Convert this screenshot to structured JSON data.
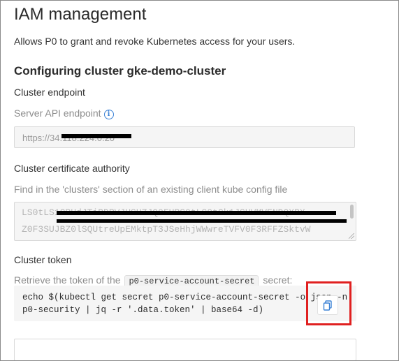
{
  "page": {
    "title": "IAM management",
    "description": "Allows P0 to grant and revoke Kubernetes access for your users.",
    "section_title": "Configuring cluster gke-demo-cluster"
  },
  "endpoint": {
    "label": "Cluster endpoint",
    "help": "Server API endpoint",
    "value": "https://34.118.224.0.20"
  },
  "certificate": {
    "label": "Cluster certificate authority",
    "help": "Find in the 'clusters' section of an existing client kube config file",
    "line1": "LS0tLS1CRUdJTiBDRVJUSUZJQ0FURS0tLS0tCk1JSUVMVENDQXBX",
    "line2": "Z0F3SUJBZ0lSQUtreUpEMktpT3JSeHhjWWwreTVFV0F3RFFZSktvW"
  },
  "token": {
    "label": "Cluster token",
    "help_prefix": "Retrieve the token of the",
    "secret_name": "p0-service-account-secret",
    "help_suffix": "secret:",
    "command_line1": "echo $(kubectl get secret p0-service-account-secret -o json -n",
    "command_line2": "p0-security | jq -r '.data.token' | base64 -d)"
  },
  "icons": {
    "info": "info-icon",
    "copy": "copy-icon"
  },
  "colors": {
    "accent": "#3b82d6",
    "highlight": "#e02020"
  }
}
